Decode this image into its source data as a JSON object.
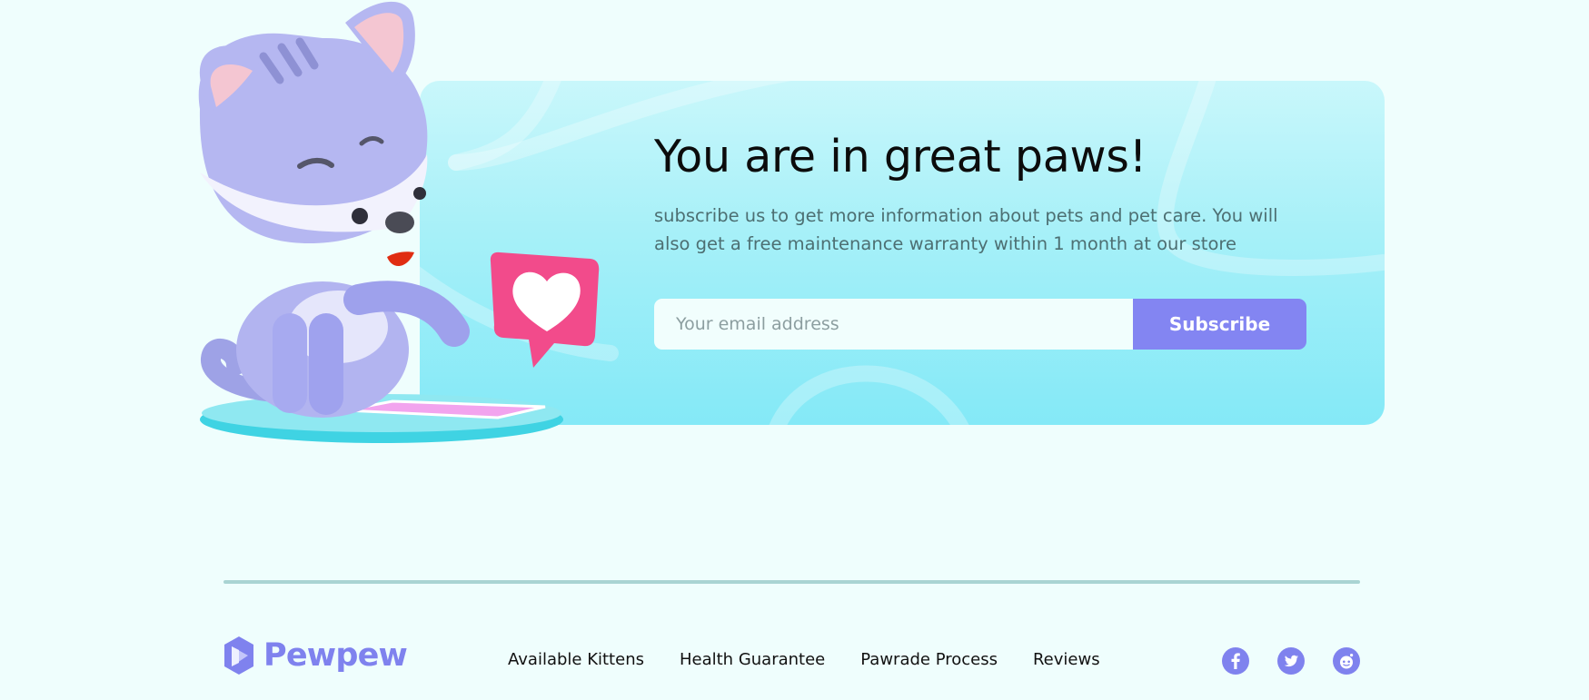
{
  "banner": {
    "title": "You are in great paws!",
    "description": "subscribe us to get more information about pets and pet care. You will also get a free maintenance warranty within 1 month at our store",
    "email_placeholder": "Your email address",
    "email_value": "",
    "subscribe_label": "Subscribe"
  },
  "footer": {
    "brand": "Pewpew",
    "nav": [
      {
        "label": "Available Kittens"
      },
      {
        "label": "Health Guarantee"
      },
      {
        "label": "Pawrade Process"
      },
      {
        "label": "Reviews"
      }
    ],
    "social": [
      "facebook-icon",
      "twitter-icon",
      "reddit-icon"
    ]
  },
  "colors": {
    "background": "#effefd",
    "banner_top": "#c9f7fb",
    "banner_bottom": "#84e9f7",
    "accent": "#8385f2",
    "heart_badge": "#f24b8b",
    "divider": "#a9d4d3"
  },
  "icons": {
    "illustration": "cat-with-heart-notification",
    "logo": "hexagon-play-logo-icon"
  }
}
